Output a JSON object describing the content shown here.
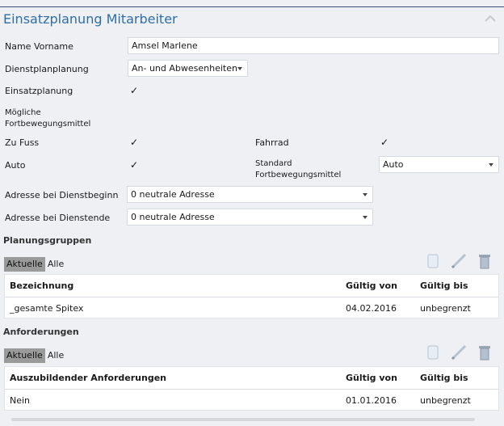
{
  "header": {
    "title": "Einsatzplanung Mitarbeiter"
  },
  "form": {
    "name_label": "Name Vorname",
    "name_value": "Amsel Marlene",
    "dienstplan_label": "Dienstplanplanung",
    "dienstplan_value": "An- und Abwesenheiten",
    "einsatz_label": "Einsatzplanung",
    "moegliche_label_1": "Mögliche",
    "moegliche_label_2": "Fortbewegungsmittel",
    "zufuss_label": "Zu Fuss",
    "fahrrad_label": "Fahrrad",
    "auto_label": "Auto",
    "standard_label_1": "Standard",
    "standard_label_2": "Fortbewegungsmittel",
    "standard_value": "Auto",
    "beginn_label": "Adresse bei Dienstbeginn",
    "beginn_value": "0 neutrale Adresse",
    "ende_label": "Adresse bei Dienstende",
    "ende_value": "0 neutrale Adresse",
    "check_glyph": "✓"
  },
  "planungsgruppen": {
    "title": "Planungsgruppen",
    "tab_current": "Aktuelle",
    "tab_all": "Alle",
    "columns": [
      "Bezeichnung",
      "Gültig von",
      "Gültig bis"
    ],
    "rows": [
      [
        "_gesamte Spitex",
        "04.02.2016",
        "unbegrenzt"
      ]
    ]
  },
  "anforderungen": {
    "title": "Anforderungen",
    "tab_current": "Aktuelle",
    "tab_all": "Alle",
    "columns": [
      "Auszubildender Anforderungen",
      "Gültig von",
      "Gültig bis"
    ],
    "rows": [
      [
        "Nein",
        "01.01.2016",
        "unbegrenzt"
      ]
    ]
  },
  "icons": {
    "collapse": "chevron-up-icon",
    "new": "new-document-icon",
    "edit": "pencil-icon",
    "delete": "trash-icon"
  },
  "colors": {
    "title": "#2f6ea6",
    "active_tab": "#9a9a9a"
  }
}
